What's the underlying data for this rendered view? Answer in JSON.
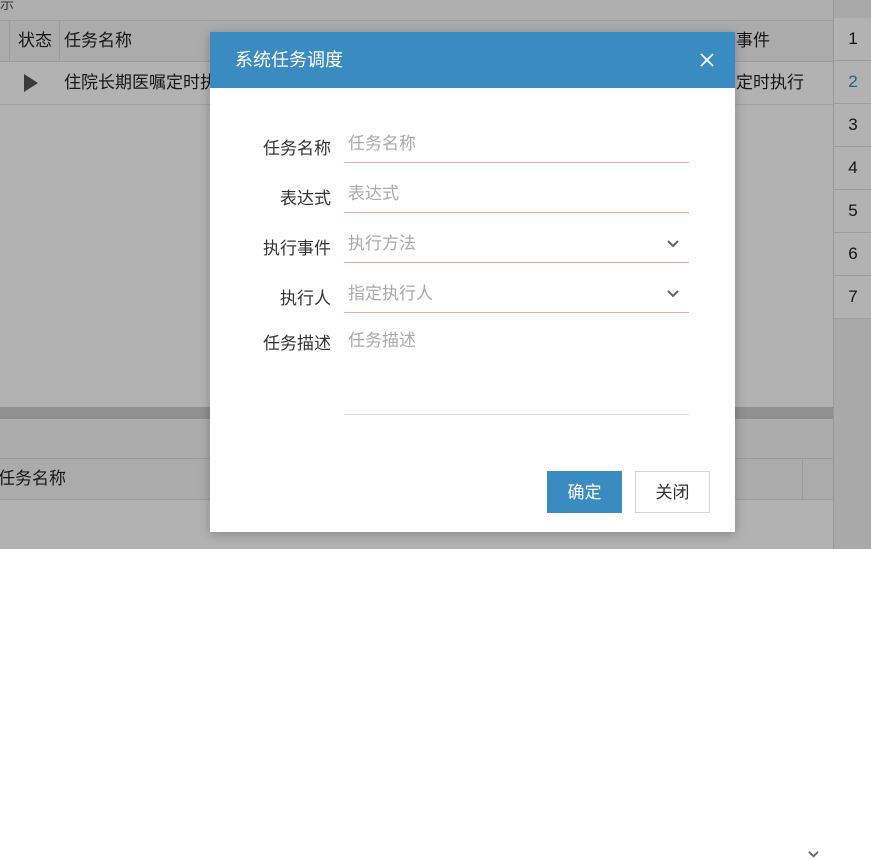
{
  "background": {
    "top_strip_text": "示",
    "grid_headers": [
      "状态",
      "任务名称",
      "事件"
    ],
    "grid_row": {
      "task_name": "住院长期医嘱定时执",
      "event": "定时执行"
    },
    "row_numbers": [
      "1",
      "2",
      "3",
      "4",
      "5",
      "6",
      "7"
    ],
    "active_row": "2",
    "panel2_column": "任务名称"
  },
  "dialog": {
    "title": "系统任务调度",
    "fields": {
      "task_name": {
        "label": "任务名称",
        "placeholder": "任务名称"
      },
      "expression": {
        "label": "表达式",
        "placeholder": "表达式"
      },
      "event": {
        "label": "执行事件",
        "placeholder": "执行方法"
      },
      "executor": {
        "label": "执行人",
        "placeholder": "指定执行人"
      },
      "description": {
        "label": "任务描述",
        "placeholder": "任务描述"
      }
    },
    "confirm_label": "确定",
    "close_label": "关闭"
  },
  "colors": {
    "accent": "#3a8cc0",
    "field_underline": "#f0a8a8"
  }
}
